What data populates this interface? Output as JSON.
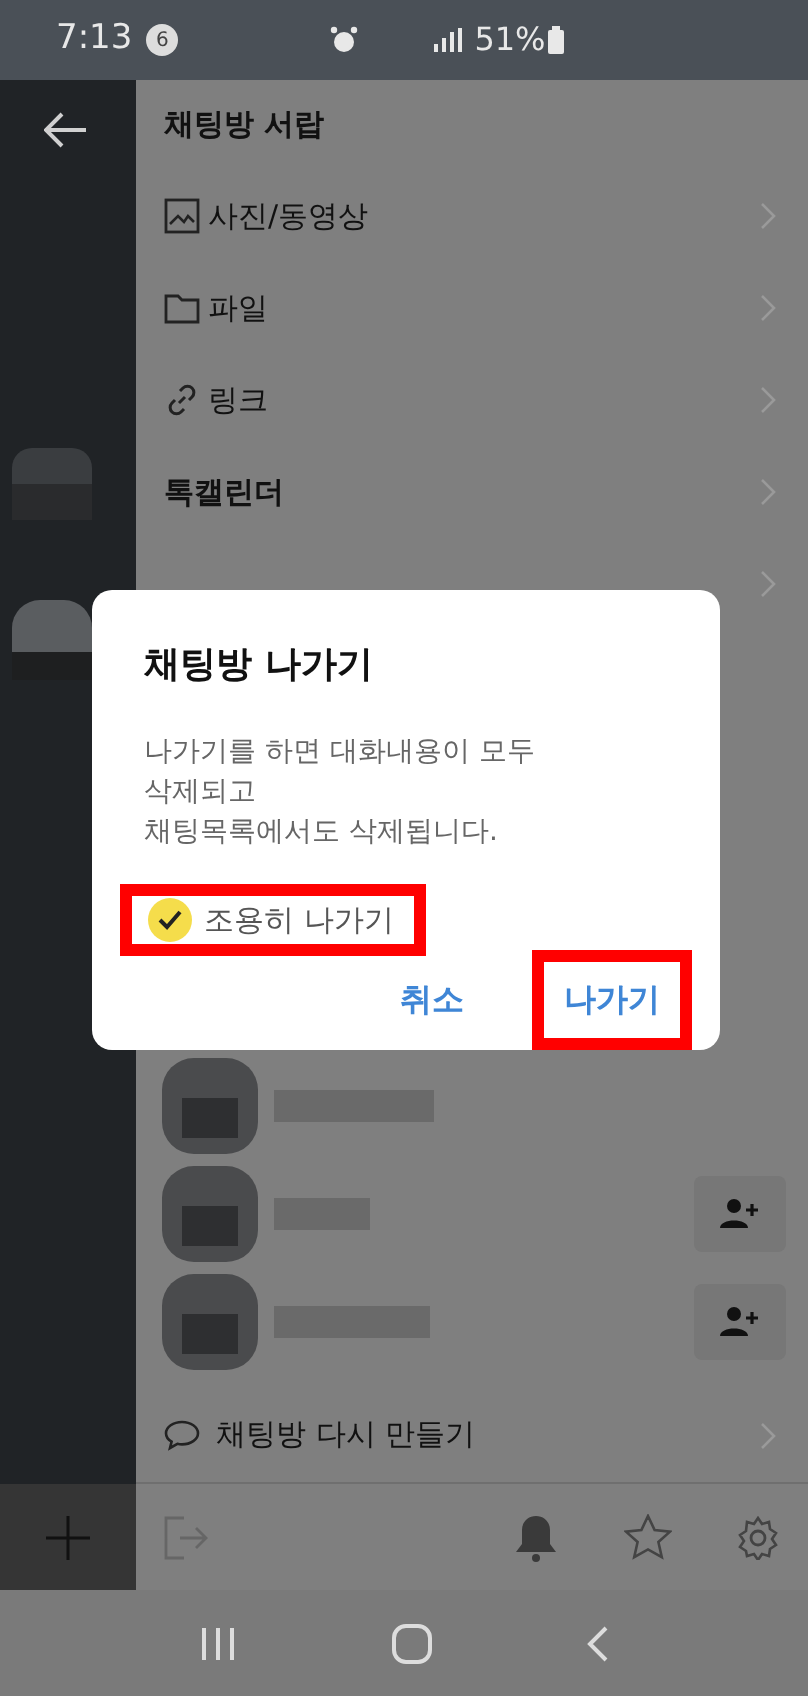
{
  "status_bar": {
    "time": "7:13",
    "notification_count": "6",
    "battery": "51%"
  },
  "drawer": {
    "title": "채팅방 서랍",
    "items": [
      {
        "kind": "media",
        "label": "사진/동영상"
      },
      {
        "kind": "file",
        "label": "파일"
      },
      {
        "kind": "link",
        "label": "링크"
      },
      {
        "kind": "plain",
        "label": "톡캘린더"
      }
    ],
    "members": [
      {
        "add_button": false
      },
      {
        "add_button": true
      },
      {
        "add_button": true
      }
    ],
    "recreate": "채팅방 다시 만들기"
  },
  "dialog": {
    "title": "채팅방 나가기",
    "message": [
      "나가기를 하면 대화내용이 모두",
      "삭제되고",
      "채팅목록에서도 삭제됩니다."
    ],
    "quiet_option": {
      "label": "조용히 나가기",
      "checked": true,
      "highlighted": true
    },
    "buttons": [
      {
        "label": "취소",
        "highlighted": false
      },
      {
        "label": "나가기",
        "highlighted": true
      }
    ]
  }
}
